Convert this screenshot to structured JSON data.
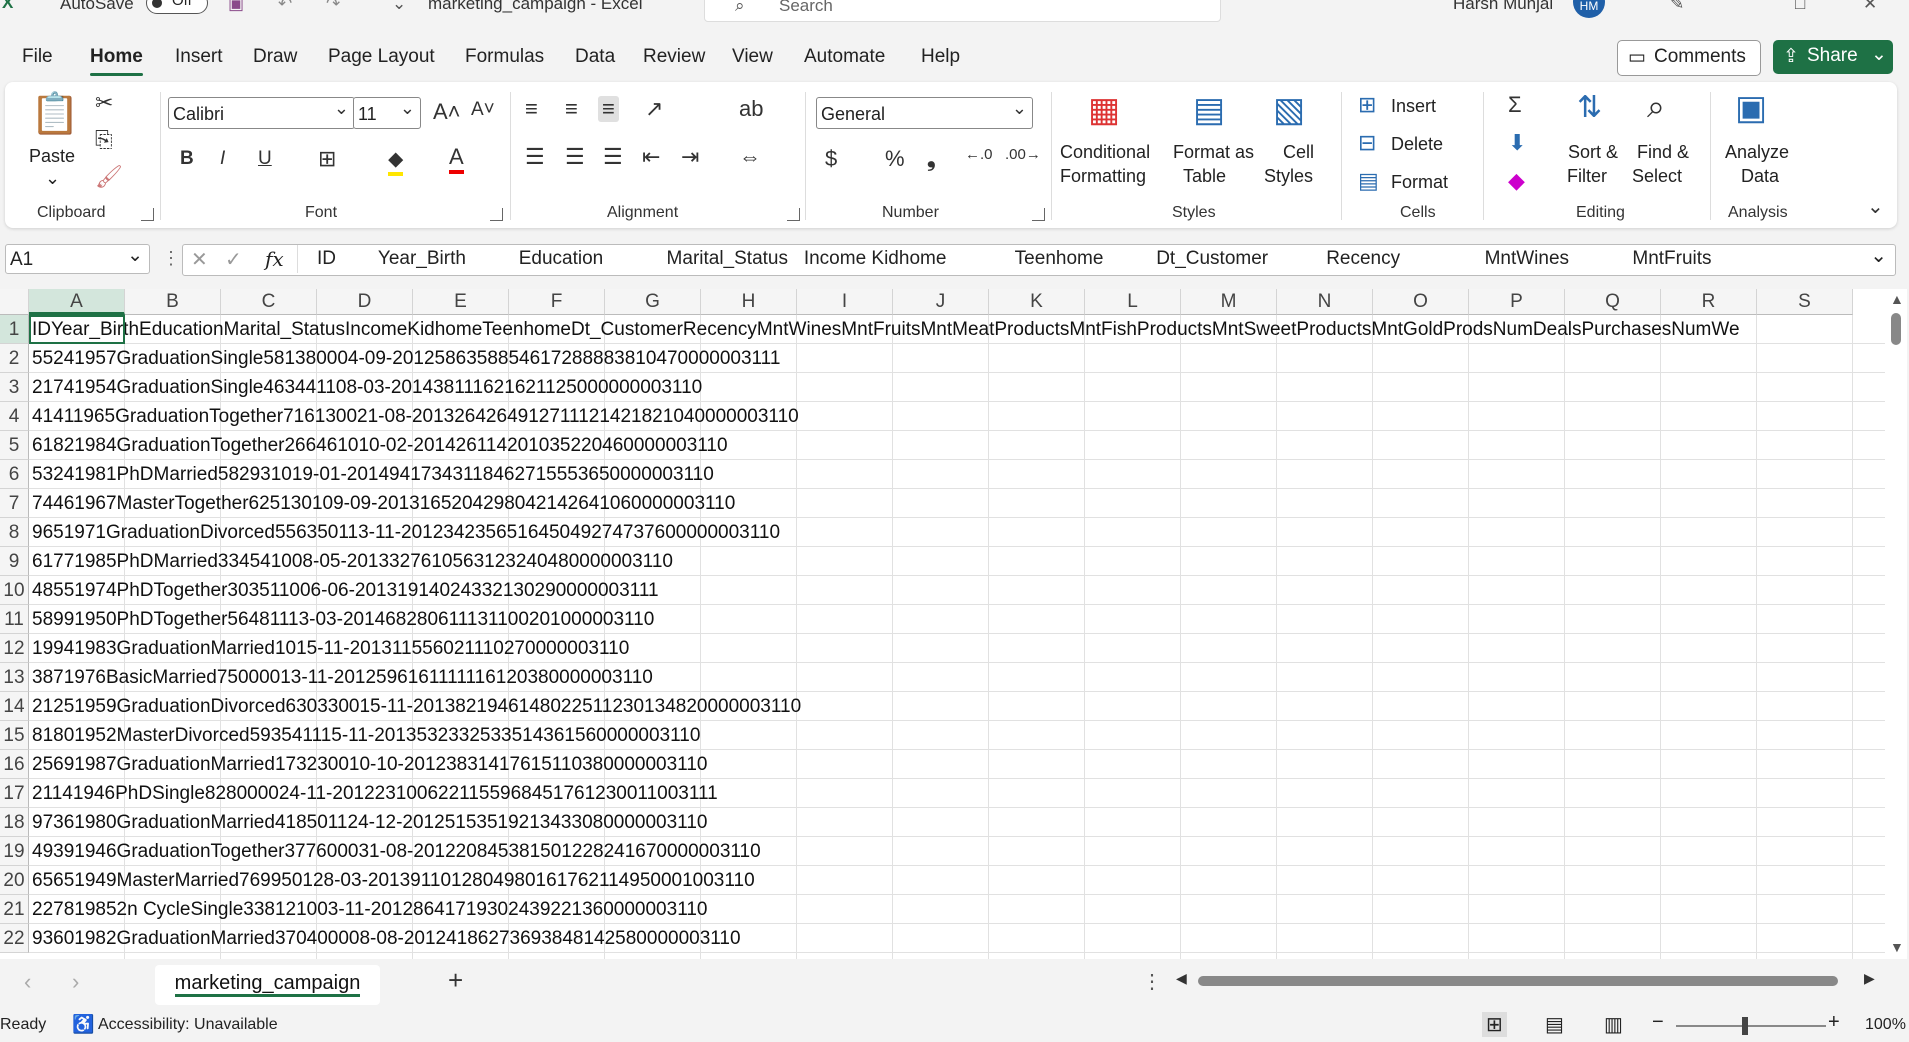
{
  "titlebar": {
    "autosave_label": "AutoSave",
    "autosave_state": "Off",
    "title": "marketing_campaign  -  Excel",
    "search_placeholder": "Search",
    "user_name": "Harsh Munjal",
    "user_initials": "HM"
  },
  "menu": {
    "items": [
      "File",
      "Home",
      "Insert",
      "Draw",
      "Page Layout",
      "Formulas",
      "Data",
      "Review",
      "View",
      "Automate",
      "Help"
    ],
    "active": "Home",
    "comments_label": "Comments",
    "share_label": "Share"
  },
  "ribbon": {
    "clipboard": {
      "label": "Clipboard",
      "paste": "Paste"
    },
    "font": {
      "label": "Font",
      "name": "Calibri",
      "size": "11"
    },
    "alignment": {
      "label": "Alignment"
    },
    "number": {
      "label": "Number",
      "format": "General"
    },
    "styles": {
      "label": "Styles",
      "conditional_1": "Conditional",
      "conditional_2": "Formatting",
      "format_table_1": "Format as",
      "format_table_2": "Table",
      "cell_styles_1": "Cell",
      "cell_styles_2": "Styles"
    },
    "cells": {
      "label": "Cells",
      "insert": "Insert",
      "delete": "Delete",
      "format": "Format"
    },
    "editing": {
      "label": "Editing",
      "sort_1": "Sort &",
      "sort_2": "Filter",
      "find_1": "Find &",
      "find_2": "Select"
    },
    "analysis": {
      "label": "Analysis",
      "analyze_1": "Analyze",
      "analyze_2": "Data"
    }
  },
  "formula_bar": {
    "name_box": "A1",
    "fx": "fx",
    "content": "ID        Year_Birth          Education            Marital_Status   Income Kidhome             Teenhome          Dt_Customer           Recency                MntWines            MntFruits"
  },
  "grid": {
    "columns": [
      "A",
      "B",
      "C",
      "D",
      "E",
      "F",
      "G",
      "H",
      "I",
      "J",
      "K",
      "L",
      "M",
      "N",
      "O",
      "P",
      "Q",
      "R",
      "S"
    ],
    "active_column": "A",
    "rows": [
      {
        "n": "1",
        "text": "IDYear_BirthEducationMarital_StatusIncomeKidhomeTeenhomeDt_CustomerRecencyMntWinesMntFruitsMntMeatProductsMntFishProductsMntSweetProductsMntGoldProdsNumDealsPurchasesNumWe"
      },
      {
        "n": "2",
        "text": "55241957GraduationSingle581380004-09-20125863588546172888838104700000031​11"
      },
      {
        "n": "3",
        "text": "21741954GraduationSingle463441108-03-201438111621621125000000003110"
      },
      {
        "n": "4",
        "text": "41411965GraduationTogether716130021-08-20132642649127111214218210400000031​10"
      },
      {
        "n": "5",
        "text": "61821984GraduationTogether266461010-02-201426114201035220460000003110"
      },
      {
        "n": "6",
        "text": "53241981PhDMarried582931019-01-20149417343118462715553650000003110"
      },
      {
        "n": "7",
        "text": "74461967MasterTogether625130109-09-2013165204298042142641060000003110"
      },
      {
        "n": "8",
        "text": "9651971GraduationDivorced556350113-11-2012342356516450492747376000000031​10"
      },
      {
        "n": "9",
        "text": "61771985PhDMarried334541008-05-20133276105631232404800000031​10"
      },
      {
        "n": "10",
        "text": "48551974PhDTogether303511006-06-201319140243321302900000031​11"
      },
      {
        "n": "11",
        "text": "58991950PhDTogether56481113-03-201468280611131100201000003110"
      },
      {
        "n": "12",
        "text": "19941983GraduationMarried1015-11-201311556021110270000003110"
      },
      {
        "n": "13",
        "text": "3871976BasicMarried75000013-11-20125961611111161203800000031​10"
      },
      {
        "n": "14",
        "text": "21251959GraduationDivorced630330015-11-20138219461480225112301348200000031​10"
      },
      {
        "n": "15",
        "text": "81801952MasterDivorced593541115-11-2013532332533514361560000003110"
      },
      {
        "n": "16",
        "text": "25691987GraduationMarried173230010-10-201238314176151103800000031​10"
      },
      {
        "n": "17",
        "text": "21141946PhDSingle828000024-11-201223100622115596845176123001100311​1"
      },
      {
        "n": "18",
        "text": "97361980GraduationMarried418501124-12-201251535192134330800000031​10"
      },
      {
        "n": "19",
        "text": "49391946GraduationTogether377600031-08-20122084538150122824167000000311​0"
      },
      {
        "n": "20",
        "text": "65651949MasterMarried769950128-03-201391101280498016176211495000100311​0"
      },
      {
        "n": "21",
        "text": "227819852n CycleSingle338121003-11-20128641719302439221360000003110"
      },
      {
        "n": "22",
        "text": "93601982GraduationMarried370400008-08-201241862736938481425800000031​10"
      }
    ]
  },
  "sheet_tabs": {
    "active": "marketing_campaign",
    "add": "+"
  },
  "status": {
    "ready": "Ready",
    "accessibility": "Accessibility: Unavailable",
    "zoom_minus": "−",
    "zoom_plus": "+",
    "zoom": "100%"
  }
}
